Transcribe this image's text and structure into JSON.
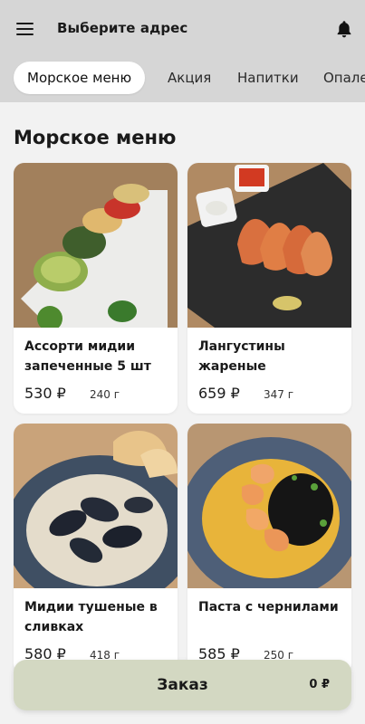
{
  "header": {
    "title": "Выберите адрес",
    "menu_icon": "hamburger-menu-icon",
    "bell_icon": "bell-icon"
  },
  "tabs": [
    {
      "label": "Морское меню",
      "active": true
    },
    {
      "label": "Акция",
      "active": false
    },
    {
      "label": "Напитки",
      "active": false
    },
    {
      "label": "Опале",
      "active": false
    }
  ],
  "section": {
    "title": "Морское меню"
  },
  "products": [
    {
      "name": "Ассорти мидии запеченные 5 шт",
      "price": "530 ₽",
      "weight": "240 г"
    },
    {
      "name": "Лангустины жареные",
      "price": "659 ₽",
      "weight": "347 г"
    },
    {
      "name": "Мидии тушеные в сливках",
      "price": "580 ₽",
      "weight": "418 г"
    },
    {
      "name": "Паста с чернилами",
      "price": "585 ₽",
      "weight": "250 г"
    }
  ],
  "order": {
    "label": "Заказ",
    "total": "0 ₽"
  },
  "colors": {
    "header_bg": "#d6d6d6",
    "page_bg": "#f2f2f2",
    "order_button": "#d3d8c2"
  }
}
